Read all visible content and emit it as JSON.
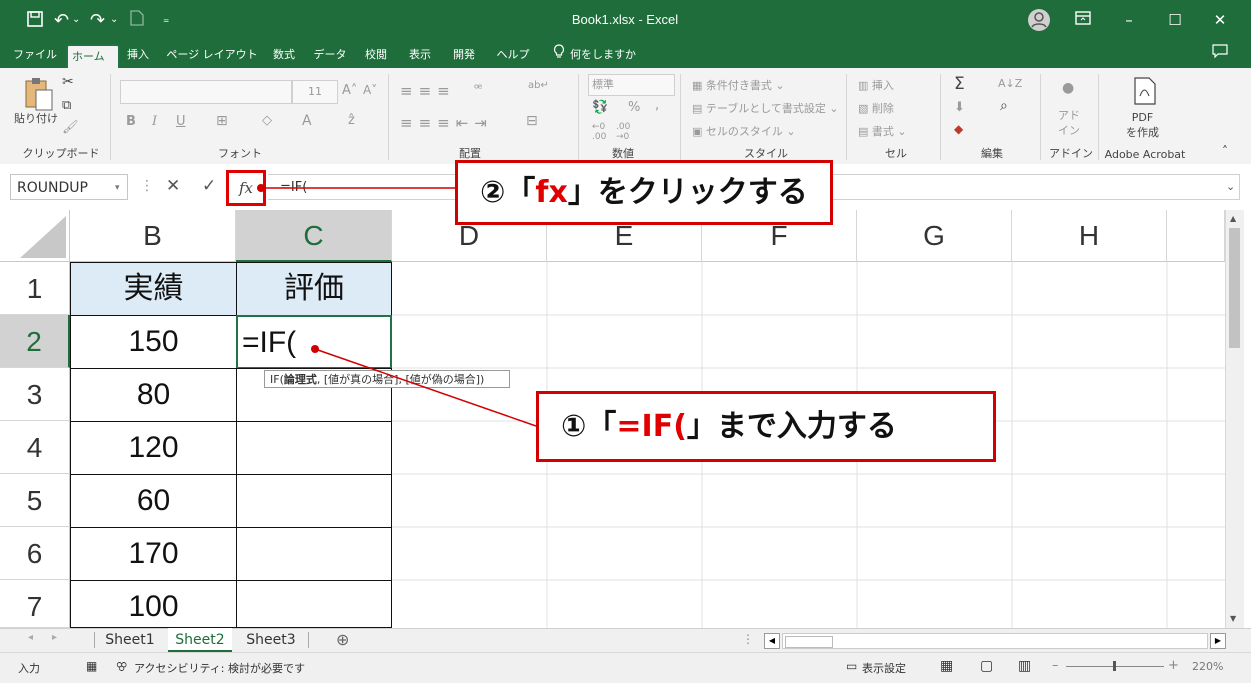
{
  "window": {
    "title": "Book1.xlsx  -  Excel",
    "qat_icons": [
      "autosave-icon",
      "undo-icon",
      "redo-icon",
      "new-file-icon",
      "customize-qat-icon"
    ]
  },
  "menu": {
    "tabs": [
      "ファイル",
      "ホーム",
      "挿入",
      "ページ レイアウト",
      "数式",
      "データ",
      "校閲",
      "表示",
      "開発",
      "ヘルプ"
    ],
    "active_tab": "ホーム",
    "tell_me": "何をしますか"
  },
  "ribbon": {
    "clipboard": {
      "paste": "貼り付け",
      "group": "クリップボード"
    },
    "font": {
      "size": "11",
      "bold": "B",
      "italic": "I",
      "underline": "U",
      "group": "フォント"
    },
    "alignment": {
      "group": "配置"
    },
    "number": {
      "format": "標準",
      "percent": "%",
      "group": "数値"
    },
    "styles": {
      "conditional": "条件付き書式 ⌄",
      "table": "テーブルとして書式設定 ⌄",
      "cell_styles": "セルのスタイル ⌄",
      "group": "スタイル"
    },
    "cells": {
      "insert": "挿入",
      "delete": "削除",
      "format": "書式 ⌄",
      "group": "セル"
    },
    "editing": {
      "group": "編集"
    },
    "addins": {
      "label": "アド\nイン",
      "group": "アドイン"
    },
    "acrobat": {
      "label": "PDF\nを作成",
      "group": "Adobe Acrobat"
    }
  },
  "formula_bar": {
    "name_box": "ROUNDUP",
    "fx_label": "fx",
    "content": "=IF("
  },
  "columns": [
    "B",
    "C",
    "D",
    "E",
    "F",
    "G",
    "H"
  ],
  "rows": [
    "1",
    "2",
    "3",
    "4",
    "5",
    "6",
    "7"
  ],
  "table": {
    "header": [
      "実績",
      "評価"
    ],
    "values": [
      "150",
      "80",
      "120",
      "60",
      "170",
      "100"
    ],
    "active_cell_text": "=IF("
  },
  "tooltip": {
    "text_start": "IF(",
    "text_bold": "論理式",
    "text_end": ", [値が真の場合], [値が偽の場合])"
  },
  "callouts": {
    "c2": {
      "num": "②",
      "open": "「",
      "key": "fx",
      "close": "」",
      "rest": "をクリックする"
    },
    "c1": {
      "num": "①",
      "open": "「",
      "key": "=IF(",
      "close": "」",
      "rest": "まで入力する"
    }
  },
  "sheets": {
    "tabs": [
      "Sheet1",
      "Sheet2",
      "Sheet3"
    ],
    "active": "Sheet2"
  },
  "status": {
    "mode": "入力",
    "accessibility": "アクセシビリティ: 検討が必要です",
    "display_settings": "表示設定",
    "zoom": "220%"
  }
}
